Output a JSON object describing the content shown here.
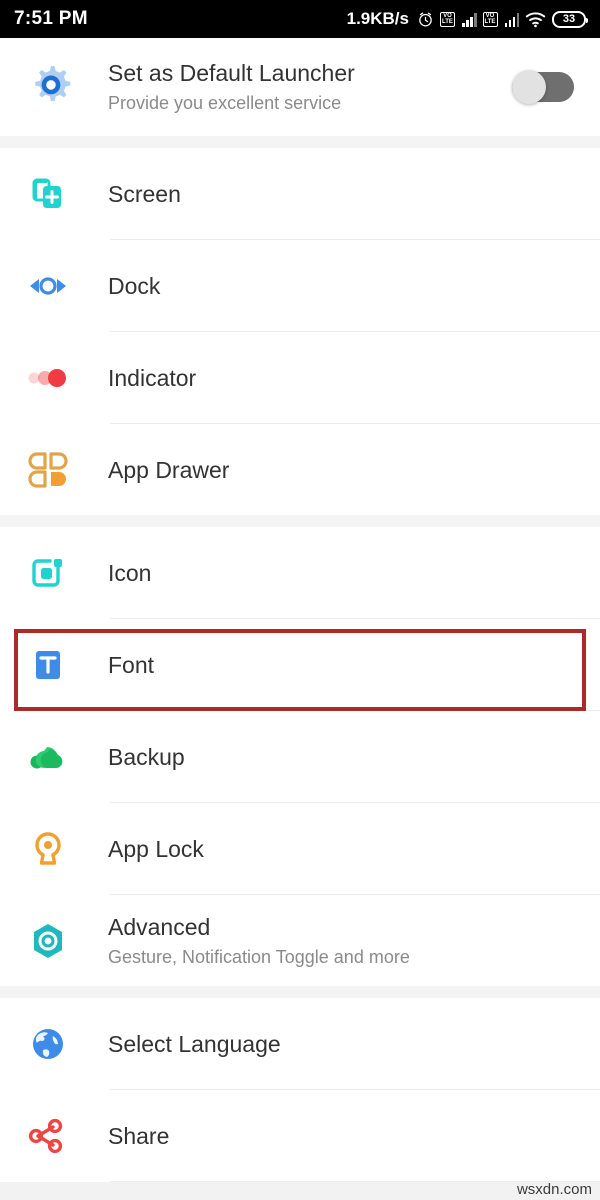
{
  "statusbar": {
    "time": "7:51 PM",
    "network_speed": "1.9KB/s",
    "alarm_icon": "alarm-clock-icon",
    "sim1_label": "VO\nLTE",
    "sim1_top": "VO",
    "sim1_bottom": "LTE",
    "sim2_top": "VO",
    "sim2_bottom": "LTE",
    "wifi_icon": "wifi-icon",
    "battery_level": "33"
  },
  "header": {
    "icon": "gear-icon",
    "title": "Set as Default Launcher",
    "subtitle": "Provide you excellent service",
    "toggle_state": "off"
  },
  "groups": [
    {
      "name": "layout-group",
      "items": [
        {
          "icon": "screen-add-icon",
          "label": "Screen",
          "subtitle": ""
        },
        {
          "icon": "dock-arrows-icon",
          "label": "Dock",
          "subtitle": ""
        },
        {
          "icon": "indicator-dots-icon",
          "label": "Indicator",
          "subtitle": ""
        },
        {
          "icon": "app-drawer-grid-icon",
          "label": "App Drawer",
          "subtitle": ""
        }
      ]
    },
    {
      "name": "appearance-group",
      "items": [
        {
          "icon": "icon-square-icon",
          "label": "Icon",
          "subtitle": ""
        },
        {
          "icon": "font-t-icon",
          "label": "Font",
          "subtitle": ""
        },
        {
          "icon": "backup-cloud-icon",
          "label": "Backup",
          "subtitle": ""
        },
        {
          "icon": "app-lock-key-icon",
          "label": "App Lock",
          "subtitle": ""
        },
        {
          "icon": "advanced-hexagon-icon",
          "label": "Advanced",
          "subtitle": "Gesture, Notification Toggle and more"
        }
      ]
    },
    {
      "name": "misc-group",
      "items": [
        {
          "icon": "globe-icon",
          "label": "Select Language",
          "subtitle": ""
        },
        {
          "icon": "share-nodes-icon",
          "label": "Share",
          "subtitle": ""
        }
      ]
    }
  ],
  "annotation": {
    "type": "red-highlight-rectangle",
    "target": "Font",
    "color": "#ad2a2a"
  },
  "watermark": "wsxdn.com",
  "colors": {
    "teal": "#1ed2cd",
    "blue": "#3f8ce8",
    "red": "#ef4444",
    "orange": "#f0a030",
    "green": "#19b65c",
    "toggle_track": "#6f6f6f",
    "divider": "#ececec",
    "background": "#f4f4f4"
  }
}
